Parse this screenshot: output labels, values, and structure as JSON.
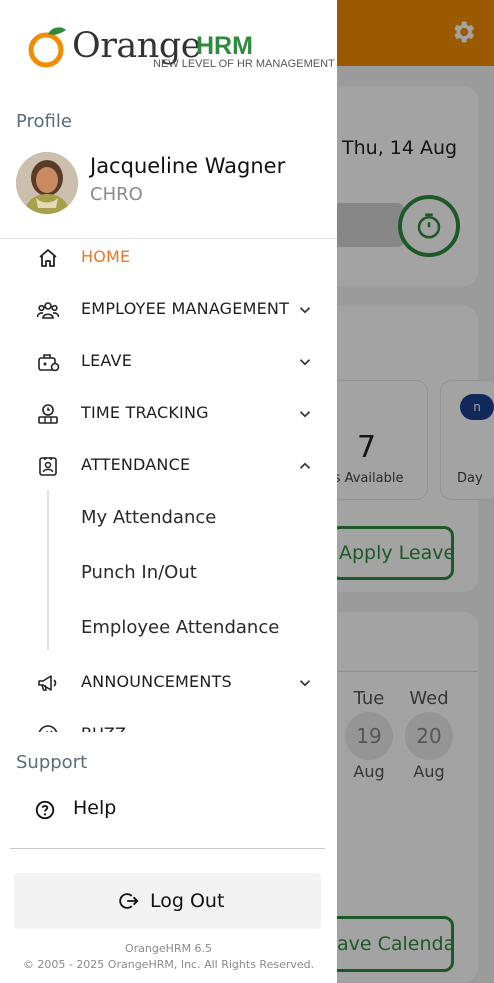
{
  "brand": {
    "name_main": "Orange",
    "name_hrm": "HRM",
    "tagline": "NEW LEVEL OF HR MANAGEMENT",
    "colors": {
      "orange": "#f28c00",
      "green": "#2e8b3e",
      "active": "#e8792a"
    }
  },
  "profile": {
    "section_label": "Profile",
    "name": "Jacqueline Wagner",
    "role": "CHRO"
  },
  "menu": [
    {
      "label": "HOME",
      "icon": "home-icon",
      "active": true,
      "chevron": "none"
    },
    {
      "label": "EMPLOYEE MANAGEMENT",
      "icon": "employees-icon",
      "active": false,
      "chevron": "down"
    },
    {
      "label": "LEAVE",
      "icon": "leave-icon",
      "active": false,
      "chevron": "down"
    },
    {
      "label": "TIME TRACKING",
      "icon": "time-tracking-icon",
      "active": false,
      "chevron": "down"
    },
    {
      "label": "ATTENDANCE",
      "icon": "attendance-icon",
      "active": false,
      "chevron": "up"
    },
    {
      "label": "ANNOUNCEMENTS",
      "icon": "megaphone-icon",
      "active": false,
      "chevron": "down"
    },
    {
      "label": "BUZZ",
      "icon": "buzz-icon",
      "active": false,
      "chevron": "none"
    }
  ],
  "attendance_submenu": [
    "My Attendance",
    "Punch In/Out",
    "Employee Attendance"
  ],
  "support": {
    "section_label": "Support",
    "help_label": "Help"
  },
  "logout_label": "Log Out",
  "footer": {
    "version": "OrangeHRM 6.5",
    "copyright": "© 2005 - 2025 OrangeHRM, Inc. All Rights Reserved."
  },
  "background": {
    "date": "Thu, 14 Aug",
    "days_available_value": "7",
    "days_available_label": "ys Available",
    "days_label_2": "Day",
    "badge": "n",
    "apply_leave": "Apply Leave",
    "leave_calendar": "ave Calendar",
    "week_days": [
      {
        "day": "Tue",
        "date": "19",
        "month": "Aug"
      },
      {
        "day": "Wed",
        "date": "20",
        "month": "Aug"
      }
    ]
  }
}
